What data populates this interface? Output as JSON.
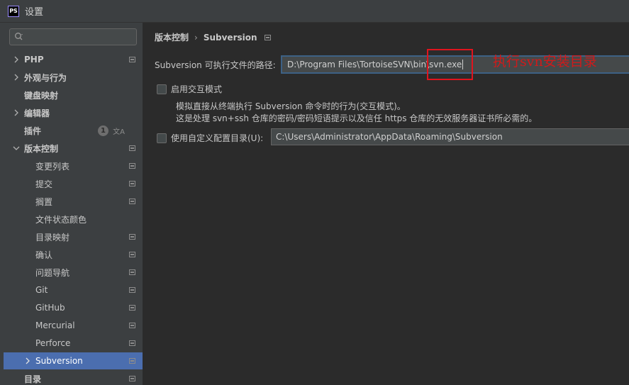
{
  "window": {
    "title": "设置",
    "app_icon_text": "PS"
  },
  "search": {
    "placeholder": "",
    "value": ""
  },
  "sidebar": {
    "items": [
      {
        "label": "PHP",
        "expandable": true
      },
      {
        "label": "外观与行为",
        "expandable": true
      },
      {
        "label": "键盘映射",
        "expandable": false
      },
      {
        "label": "编辑器",
        "expandable": true
      },
      {
        "label": "插件",
        "expandable": false,
        "badge": "1"
      },
      {
        "label": "版本控制",
        "expandable": true,
        "expanded": true
      },
      {
        "label": "变更列表"
      },
      {
        "label": "提交"
      },
      {
        "label": "搁置"
      },
      {
        "label": "文件状态颜色"
      },
      {
        "label": "目录映射"
      },
      {
        "label": "确认"
      },
      {
        "label": "问题导航"
      },
      {
        "label": "Git"
      },
      {
        "label": "GitHub"
      },
      {
        "label": "Mercurial"
      },
      {
        "label": "Perforce"
      },
      {
        "label": "Subversion",
        "selected": true
      },
      {
        "label": "目录"
      }
    ]
  },
  "breadcrumb": {
    "parent": "版本控制",
    "separator": "›",
    "current": "Subversion"
  },
  "settings": {
    "path_label": "Subversion 可执行文件的路径:",
    "path_value": "D:\\Program Files\\TortoiseSVN\\bin\\svn.exe",
    "interactive_label": "启用交互模式",
    "interactive_desc_line1": "模拟直接从终端执行 Subversion 命令时的行为(交互模式)。",
    "interactive_desc_line2": "这是处理 svn+ssh 仓库的密码/密码短语提示以及信任 https 仓库的无效服务器证书所必需的。",
    "custom_config_label": "使用自定义配置目录(U):",
    "custom_config_value": "C:\\Users\\Administrator\\AppData\\Roaming\\Subversion"
  },
  "annotation": {
    "text": "执行svn安装目录"
  },
  "colors": {
    "selected": "#4b6eaf",
    "annotation": "#d01a1a",
    "focus_border": "#3d6185"
  }
}
